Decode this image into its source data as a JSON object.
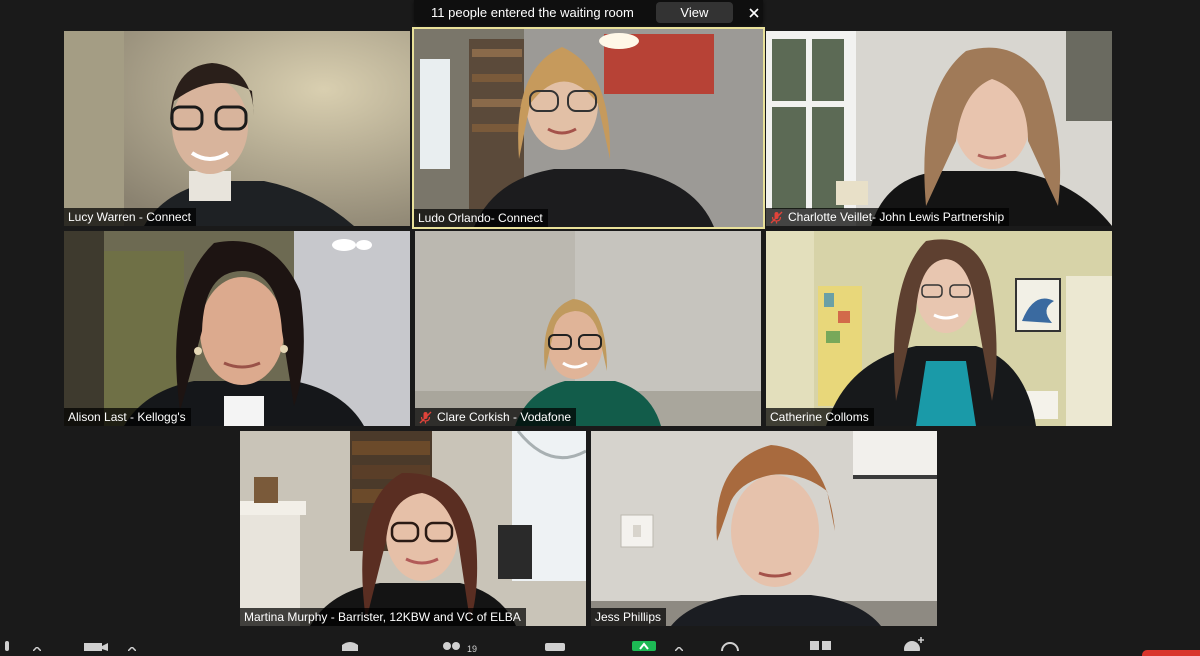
{
  "notification": {
    "message": "11 people entered the waiting room",
    "view_label": "View"
  },
  "participants": [
    {
      "name": "Lucy Warren - Connect",
      "muted": false,
      "active": false
    },
    {
      "name": "Ludo Orlando- Connect",
      "muted": false,
      "active": true
    },
    {
      "name": "Charlotte Veillet- John Lewis Partnership",
      "muted": true,
      "active": false
    },
    {
      "name": "Alison Last - Kellogg's",
      "muted": false,
      "active": false
    },
    {
      "name": "Clare Corkish - Vodafone",
      "muted": true,
      "active": false
    },
    {
      "name": "Catherine Colloms",
      "muted": false,
      "active": false
    },
    {
      "name": "Martina Murphy -  Barrister, 12KBW and VC of ELBA",
      "muted": false,
      "active": false
    },
    {
      "name": "Jess Phillips",
      "muted": false,
      "active": false
    }
  ],
  "toolbar": {
    "participants_count": "19"
  },
  "colors": {
    "background": "#1a1a1a",
    "active_speaker_border": "#e9e19a",
    "mute_icon": "#e0433a",
    "end_button": "#d9342b",
    "share_button": "#1db954"
  }
}
